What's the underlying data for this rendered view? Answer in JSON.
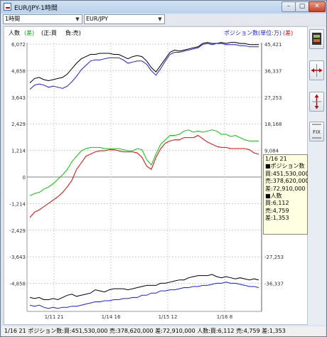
{
  "window": {
    "title": "EUR/JPY-1時間",
    "minimize_glyph": "–",
    "maximize_glyph": "▢",
    "close_glyph": "✕"
  },
  "toolbar": {
    "timeframe_value": "1時間",
    "pair_value": "EUR/JPY"
  },
  "legend": {
    "left_label": "人数",
    "left_marker": "(差)",
    "left_note": "(正:買",
    "left_note2": "負:売)",
    "right_label": "ポジション数(単位:万)",
    "right_marker": "(差)"
  },
  "axes": {
    "left_ticks": [
      "6,072",
      "4,858",
      "3,643",
      "2,429",
      "1,214",
      "0",
      "-1,214",
      "-2,429",
      "-3,643",
      "-4,858"
    ],
    "right_ticks": [
      "45,421",
      "36,337",
      "27,253",
      "18,168",
      "9,084",
      "0",
      "-9,084",
      "-18,168",
      "-27,253",
      "-36,337"
    ],
    "x_ticks": [
      "1/11 21",
      "1/14 16",
      "1/15 12",
      "1/16 8"
    ]
  },
  "tooltip": {
    "date": "1/16 21",
    "pos_header": "■ポジション数",
    "pos_buy": "買:451,530,000",
    "pos_sell": "売:378,620,000",
    "pos_diff": "差:72,910,000",
    "ppl_header": "■人数",
    "ppl_buy": "買:6,112",
    "ppl_sell": "売:4,759",
    "ppl_diff": "差:1,353"
  },
  "status_text": "1/16 21 ポジション数:買:451,530,000 売:378,620,000 差:72,910,000 人数:買:6,112 売:4,759 差:1,353",
  "side_tools": [
    {
      "name": "candle-tool-icon"
    },
    {
      "name": "zoom-horizontal-icon"
    },
    {
      "name": "zoom-vertical-icon"
    },
    {
      "name": "fix-icon",
      "label": "FIX"
    }
  ],
  "colors": {
    "buy": "#000000",
    "sell": "#1a1aff",
    "diff_green": "#00cc00",
    "diff_red": "#ee0000",
    "grid": "#cfcfcf",
    "zero": "#808080"
  },
  "chart_data": {
    "type": "line",
    "x_ticks": [
      "1/11 21",
      "1/14 16",
      "1/15 12",
      "1/16 8"
    ],
    "left_axis_ticks": [
      6072,
      4858,
      3643,
      2429,
      1214,
      0,
      -1214,
      -2429,
      -3643,
      -4858
    ],
    "right_axis_ticks": [
      45421,
      36337,
      27253,
      18168,
      9084,
      0,
      -9084,
      -18168,
      -27253,
      -36337
    ],
    "series": [
      {
        "name": "ポジション数 買",
        "color": "#000000",
        "values": [
          4300,
          4500,
          4550,
          4450,
          4400,
          4450,
          4500,
          4550,
          4700,
          4950,
          5200,
          5400,
          5500,
          5600,
          5600,
          5650,
          5650,
          5650,
          5600,
          5600,
          5500,
          5400,
          5500,
          5550,
          5500,
          5300,
          5000,
          4800,
          5100,
          5400,
          5700,
          5800,
          5750,
          5800,
          5850,
          5900,
          5950,
          6100,
          6150,
          6100,
          6100,
          6150,
          6100,
          6150,
          6150,
          6100,
          6100,
          6050,
          6050,
          6050
        ]
      },
      {
        "name": "ポジション数 売",
        "color": "#1a1aff",
        "values": [
          4000,
          4200,
          4250,
          4200,
          4100,
          4150,
          4100,
          4050,
          4150,
          4350,
          4600,
          4900,
          5100,
          5300,
          5350,
          5350,
          5400,
          5450,
          5450,
          5450,
          5350,
          5200,
          5250,
          5300,
          5300,
          5150,
          4850,
          4650,
          4950,
          5300,
          5600,
          5700,
          5700,
          5750,
          5800,
          5850,
          5900,
          6050,
          6100,
          6050,
          6100,
          6100,
          6050,
          6050,
          6050,
          6000,
          6000,
          5950,
          5950,
          5950
        ]
      },
      {
        "name": "ポジション数 差",
        "color": "#00cc00",
        "values": [
          -850,
          -750,
          -700,
          -550,
          -450,
          -300,
          -100,
          100,
          350,
          700,
          950,
          1200,
          1300,
          1350,
          1350,
          1350,
          1300,
          1300,
          1300,
          1300,
          1250,
          1200,
          1200,
          1300,
          1250,
          800,
          550,
          1050,
          1500,
          1700,
          1900,
          1900,
          1950,
          2100,
          2150,
          2050,
          2100,
          2050,
          2100,
          2150,
          2100,
          1950,
          1950,
          1850,
          1900,
          1800,
          1700,
          1650,
          1650,
          1650
        ]
      },
      {
        "name": "人数 差",
        "color": "#ee0000",
        "values": [
          -1850,
          -1600,
          -1500,
          -1350,
          -1200,
          -1050,
          -900,
          -700,
          -450,
          -150,
          350,
          650,
          950,
          1050,
          1150,
          1200,
          1200,
          1250,
          1250,
          1200,
          1150,
          1150,
          1150,
          1100,
          900,
          500,
          350,
          900,
          1300,
          1550,
          1650,
          1700,
          1700,
          1800,
          1800,
          1800,
          1900,
          1750,
          1600,
          1500,
          1400,
          1350,
          1350,
          1300,
          1300,
          1300,
          1300,
          1250,
          1100,
          1050
        ]
      },
      {
        "name": "人数 買",
        "color": "#000000",
        "values": [
          -5500,
          -5550,
          -5500,
          -5600,
          -5600,
          -5550,
          -5600,
          -5500,
          -5400,
          -5350,
          -5450,
          -5400,
          -5350,
          -5300,
          -5150,
          -5200,
          -5250,
          -5150,
          -5100,
          -5100,
          -5100,
          -5150,
          -5100,
          -5050,
          -5000,
          -4950,
          -4950,
          -4950,
          -4850,
          -4850,
          -4800,
          -4750,
          -4700,
          -4700,
          -4600,
          -4550,
          -4500,
          -4500,
          -4500,
          -4450,
          -4550,
          -4600,
          -4550,
          -4600,
          -4650,
          -4600,
          -4650,
          -4700,
          -4650,
          -4700
        ]
      },
      {
        "name": "人数 売",
        "color": "#1a1aff",
        "values": [
          -5850,
          -5900,
          -5850,
          -5950,
          -6000,
          -5950,
          -6000,
          -5950,
          -5950,
          -5900,
          -5900,
          -5850,
          -5800,
          -5750,
          -5700,
          -5700,
          -5650,
          -5650,
          -5600,
          -5600,
          -5550,
          -5550,
          -5500,
          -5500,
          -5400,
          -5400,
          -5300,
          -5300,
          -5200,
          -5200,
          -5150,
          -5150,
          -5100,
          -5050,
          -5050,
          -5000,
          -5000,
          -4950,
          -4950,
          -4900,
          -4850,
          -4850,
          -4800,
          -4850,
          -4850,
          -4900,
          -4950,
          -5000,
          -5000,
          -5050
        ]
      }
    ],
    "ylim": [
      -6200,
      6100
    ]
  }
}
